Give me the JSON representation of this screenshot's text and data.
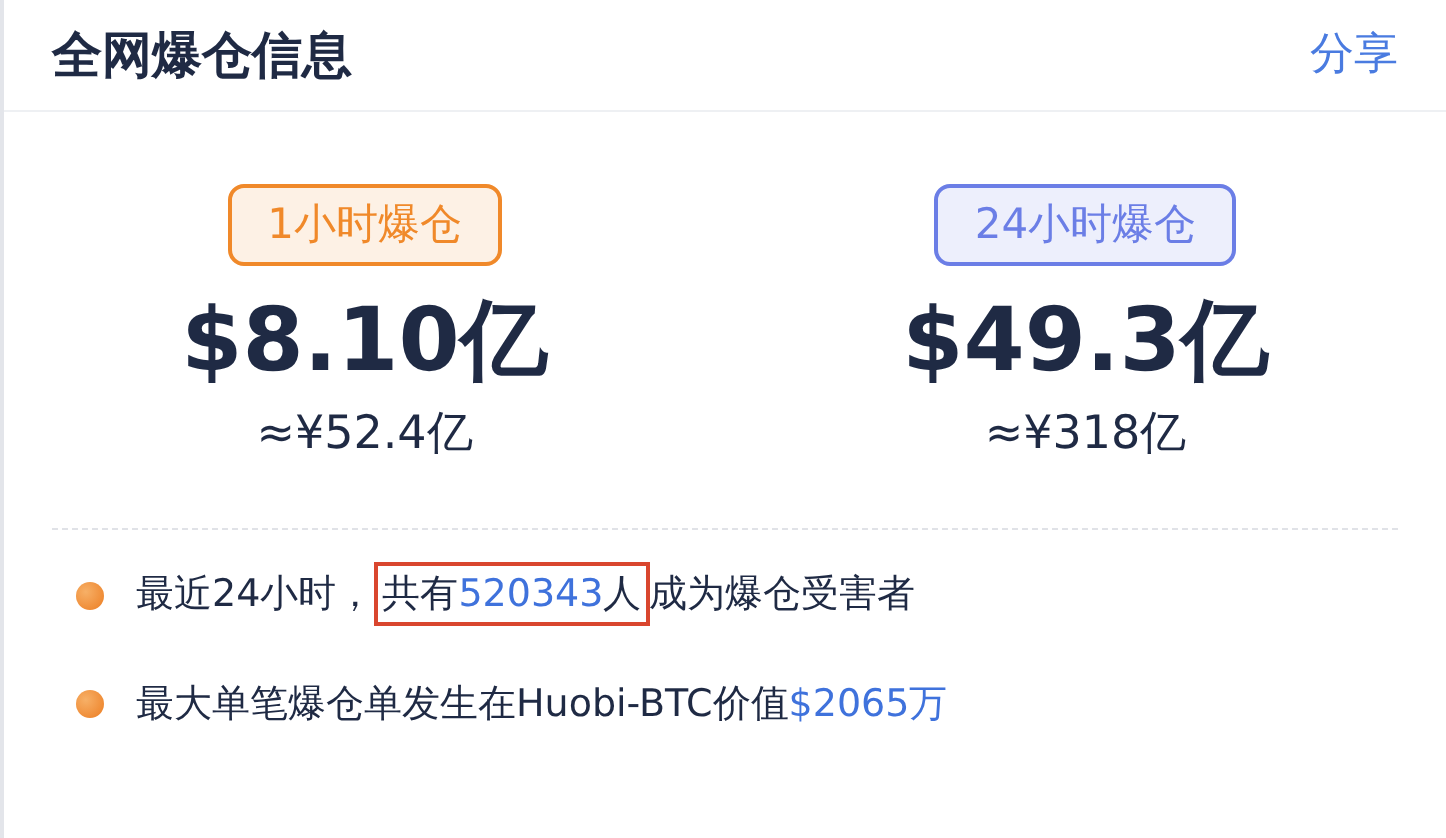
{
  "header": {
    "title": "全网爆仓信息",
    "share": "分享"
  },
  "periods": [
    {
      "label": "1小时爆仓",
      "color": "#f0892a",
      "amount": "$8.10亿",
      "cny": "≈¥52.4亿"
    },
    {
      "label": "24小时爆仓",
      "color": "#6b7ee6",
      "amount": "$49.3亿",
      "cny": "≈¥318亿"
    }
  ],
  "facts": [
    {
      "segments": [
        {
          "text": "最近24小时，",
          "kind": "plain",
          "circled": false
        },
        {
          "text": "共有",
          "kind": "plain",
          "circled": true
        },
        {
          "text": "520343",
          "kind": "number",
          "circled": true
        },
        {
          "text": "人",
          "kind": "plain",
          "circled": true
        },
        {
          "text": "成为爆仓受害者",
          "kind": "plain",
          "circled": false
        }
      ]
    },
    {
      "segments": [
        {
          "text": "最大单笔爆仓单发生在Huobi-BTC价值",
          "kind": "plain",
          "circled": false
        },
        {
          "text": "$2065万",
          "kind": "number",
          "circled": false
        }
      ]
    }
  ]
}
